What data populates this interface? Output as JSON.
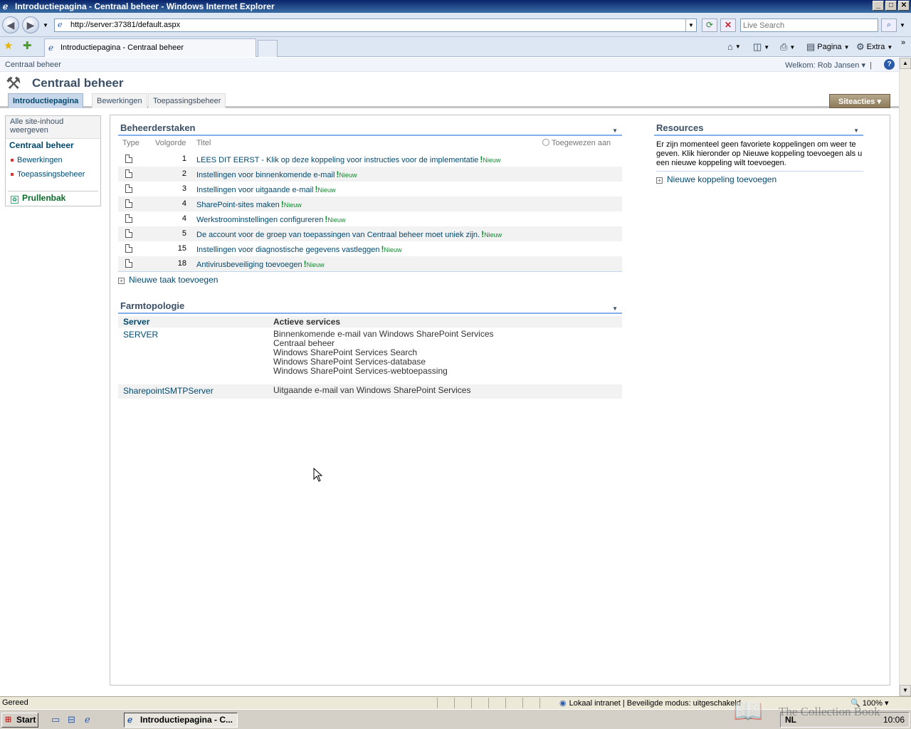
{
  "window": {
    "title": "Introductiepagina - Centraal beheer - Windows Internet Explorer",
    "minimize": "_",
    "maximize": "□",
    "close": "✕"
  },
  "browser": {
    "url": "http://server:37381/default.aspx",
    "search_placeholder": "Live Search",
    "tab_title": "Introductiepagina - Centraal beheer",
    "commands": {
      "page": "Pagina",
      "extra": "Extra"
    }
  },
  "sharepoint": {
    "breadcrumb": "Centraal beheer",
    "welcome": "Welkom: Rob Jansen",
    "site_title": "Centraal beheer",
    "top_nav": [
      "Introductiepagina",
      "Bewerkingen",
      "Toepassingsbeheer"
    ],
    "site_actions": "Siteacties",
    "left_nav": {
      "view_all": "Alle site-inhoud weergeven",
      "heading": "Centraal beheer",
      "items": [
        "Bewerkingen",
        "Toepassingsbeheer"
      ],
      "recycle_bin": "Prullenbak"
    },
    "admin_tasks": {
      "title": "Beheerderstaken",
      "columns": {
        "type": "Type",
        "order": "Volgorde",
        "title": "Titel",
        "assigned": "Toegewezen aan"
      },
      "new_label": "Nieuw",
      "rows": [
        {
          "order": "1",
          "title": "LEES DIT EERST - Klik op deze koppeling voor instructies voor de implementatie"
        },
        {
          "order": "2",
          "title": "Instellingen voor binnenkomende e-mail"
        },
        {
          "order": "3",
          "title": "Instellingen voor uitgaande e-mail"
        },
        {
          "order": "4",
          "title": "SharePoint-sites maken"
        },
        {
          "order": "4",
          "title": "Werkstroominstellingen configureren"
        },
        {
          "order": "5",
          "title": "De account voor de groep van toepassingen van Centraal beheer moet uniek zijn."
        },
        {
          "order": "15",
          "title": "Instellingen voor diagnostische gegevens vastleggen"
        },
        {
          "order": "18",
          "title": "Antivirusbeveiliging toevoegen"
        }
      ],
      "add_task": "Nieuwe taak toevoegen"
    },
    "farm_topology": {
      "title": "Farmtopologie",
      "columns": {
        "server": "Server",
        "services": "Actieve services"
      },
      "servers": [
        {
          "name": "SERVER",
          "services": [
            "Binnenkomende e-mail van Windows SharePoint Services",
            "Centraal beheer",
            "Windows SharePoint Services Search",
            "Windows SharePoint Services-database",
            "Windows SharePoint Services-webtoepassing"
          ]
        },
        {
          "name": "SharepointSMTPServer",
          "services": [
            "Uitgaande e-mail van Windows SharePoint Services"
          ]
        }
      ]
    },
    "resources": {
      "title": "Resources",
      "empty_text": "Er zijn momenteel geen favoriete koppelingen om weer te geven. Klik hieronder op Nieuwe koppeling toevoegen als u een nieuwe koppeling wilt toevoegen.",
      "add_link": "Nieuwe koppeling toevoegen"
    }
  },
  "status": {
    "text": "Gereed",
    "zone": "Lokaal intranet | Beveiligde modus: uitgeschakeld",
    "zoom": "100%"
  },
  "taskbar": {
    "start": "Start",
    "task": "Introductiepagina - C...",
    "lang": "NL",
    "clock": "10:06"
  },
  "watermark": "The Collection Book",
  "colors": {
    "link": "#03496e",
    "new_badge": "#0a8a2a",
    "title_blue": "#0a246a"
  }
}
